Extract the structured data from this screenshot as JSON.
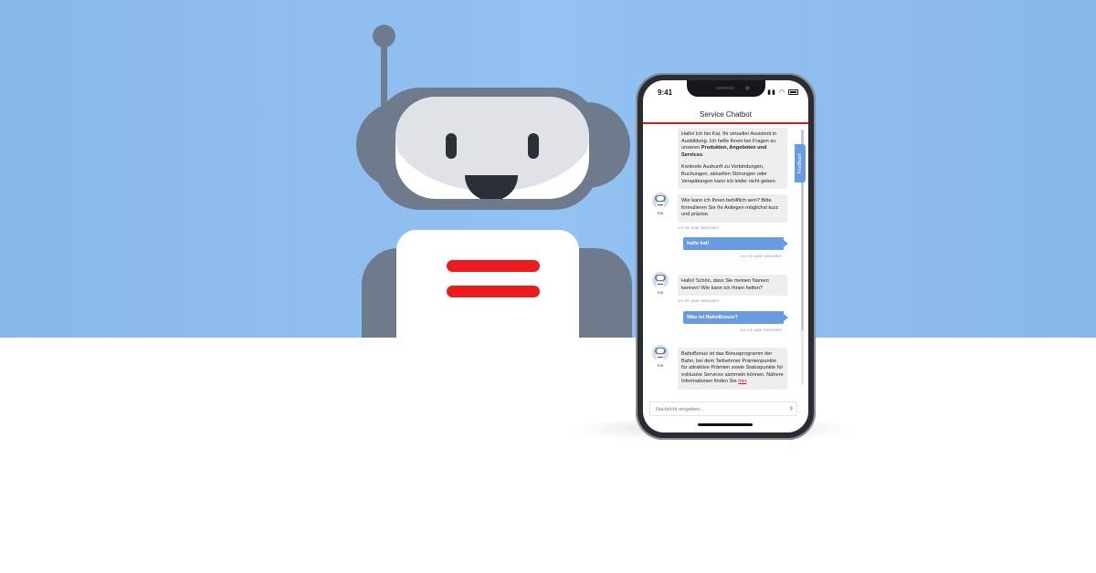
{
  "status": {
    "time": "9:41"
  },
  "chat": {
    "title": "Service Chatbot",
    "feedback_label": "Feedback",
    "bot_name": "Kai",
    "messages": {
      "intro_p1_a": "Hallo! Ich bin Kai, Ihr virtueller Assistent in Ausbildung. Ich helfe Ihnen bei Fragen zu unseren ",
      "intro_p1_bold": "Produkten, Angeboten und Services",
      "intro_p1_end": ".",
      "intro_p2": "Konkrete Auskunft zu Verbindungen, Buchungen, aktuellen Störungen oder Verspätungen kann ich leider nicht geben.",
      "intro_p3": "Wie kann ich Ihnen behilflich sein? Bitte formulieren Sie Ihr Anliegen möglichst kurz und präzise.",
      "ts1": "vor ein paar Sekunden",
      "user1": "hallo kai!",
      "ts2": "vor ein paar Sekunden",
      "bot2": "Hallo! Schön, dass Sie meinen Namen kennen! Wie kann ich Ihnen helfen?",
      "ts3": "vor ein paar Sekunden",
      "user2": "Was ist BahnBonus?",
      "ts4": "vor ein paar Sekunden",
      "bot3_text": "BahnBonus ist das Bonusprogramm der Bahn, bei dem Teilnehmer Prämienpunkte für attraktive Prämien sowie Statuspunkte für exklusive Services sammeln können. Nähere Informationen finden Sie ",
      "bot3_link": "hier",
      "bot3_end": "."
    },
    "input_placeholder": "Nachricht eingeben...",
    "send_icon": "chevron-right-icon"
  },
  "colors": {
    "sky": "#92c2f2",
    "robot_gray": "#6f7a8c",
    "accent_red": "#d7191e",
    "user_bubble": "#6a9be0",
    "bot_bubble": "#eeeeee"
  }
}
